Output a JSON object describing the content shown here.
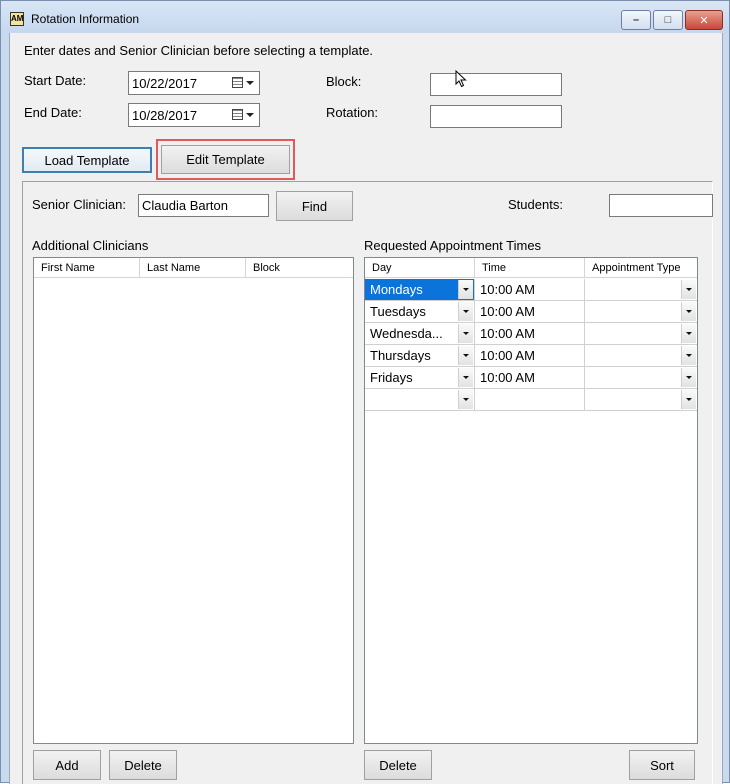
{
  "window": {
    "title": "Rotation Information",
    "icon_text": "AM",
    "controls": {
      "min": "–",
      "max": "□",
      "close": "✕"
    }
  },
  "instruction": "Enter dates and Senior Clinician before selecting a template.",
  "form": {
    "start_date_label": "Start Date:",
    "start_date_value": "10/22/2017",
    "end_date_label": "End Date:",
    "end_date_value": "10/28/2017",
    "block_label": "Block:",
    "block_value": "",
    "rotation_label": "Rotation:",
    "rotation_value": ""
  },
  "buttons": {
    "load_template": "Load Template",
    "edit_template": "Edit Template",
    "find": "Find",
    "add": "Add",
    "delete_clinician": "Delete",
    "delete_appointment": "Delete",
    "sort": "Sort"
  },
  "senior": {
    "label": "Senior Clinician:",
    "value": "Claudia Barton",
    "students_label": "Students:",
    "students_value": ""
  },
  "additional_clinicians": {
    "title": "Additional Clinicians",
    "columns": [
      "First Name",
      "Last Name",
      "Block"
    ],
    "rows": []
  },
  "appointments": {
    "title": "Requested Appointment Times",
    "columns": [
      "Day",
      "Time",
      "Appointment Type"
    ],
    "rows": [
      {
        "day": "Mondays",
        "time": "10:00 AM",
        "type": ""
      },
      {
        "day": "Tuesdays",
        "time": "10:00 AM",
        "type": ""
      },
      {
        "day": "Wednesda...",
        "time": "10:00 AM",
        "type": ""
      },
      {
        "day": "Thursdays",
        "time": "10:00 AM",
        "type": ""
      },
      {
        "day": "Fridays",
        "time": "10:00 AM",
        "type": ""
      },
      {
        "day": "",
        "time": "",
        "type": ""
      }
    ],
    "selected_row": 0
  },
  "colors": {
    "selection": "#0a74da",
    "highlight": "#e05a5a",
    "focus_border": "#3c7fb1"
  }
}
